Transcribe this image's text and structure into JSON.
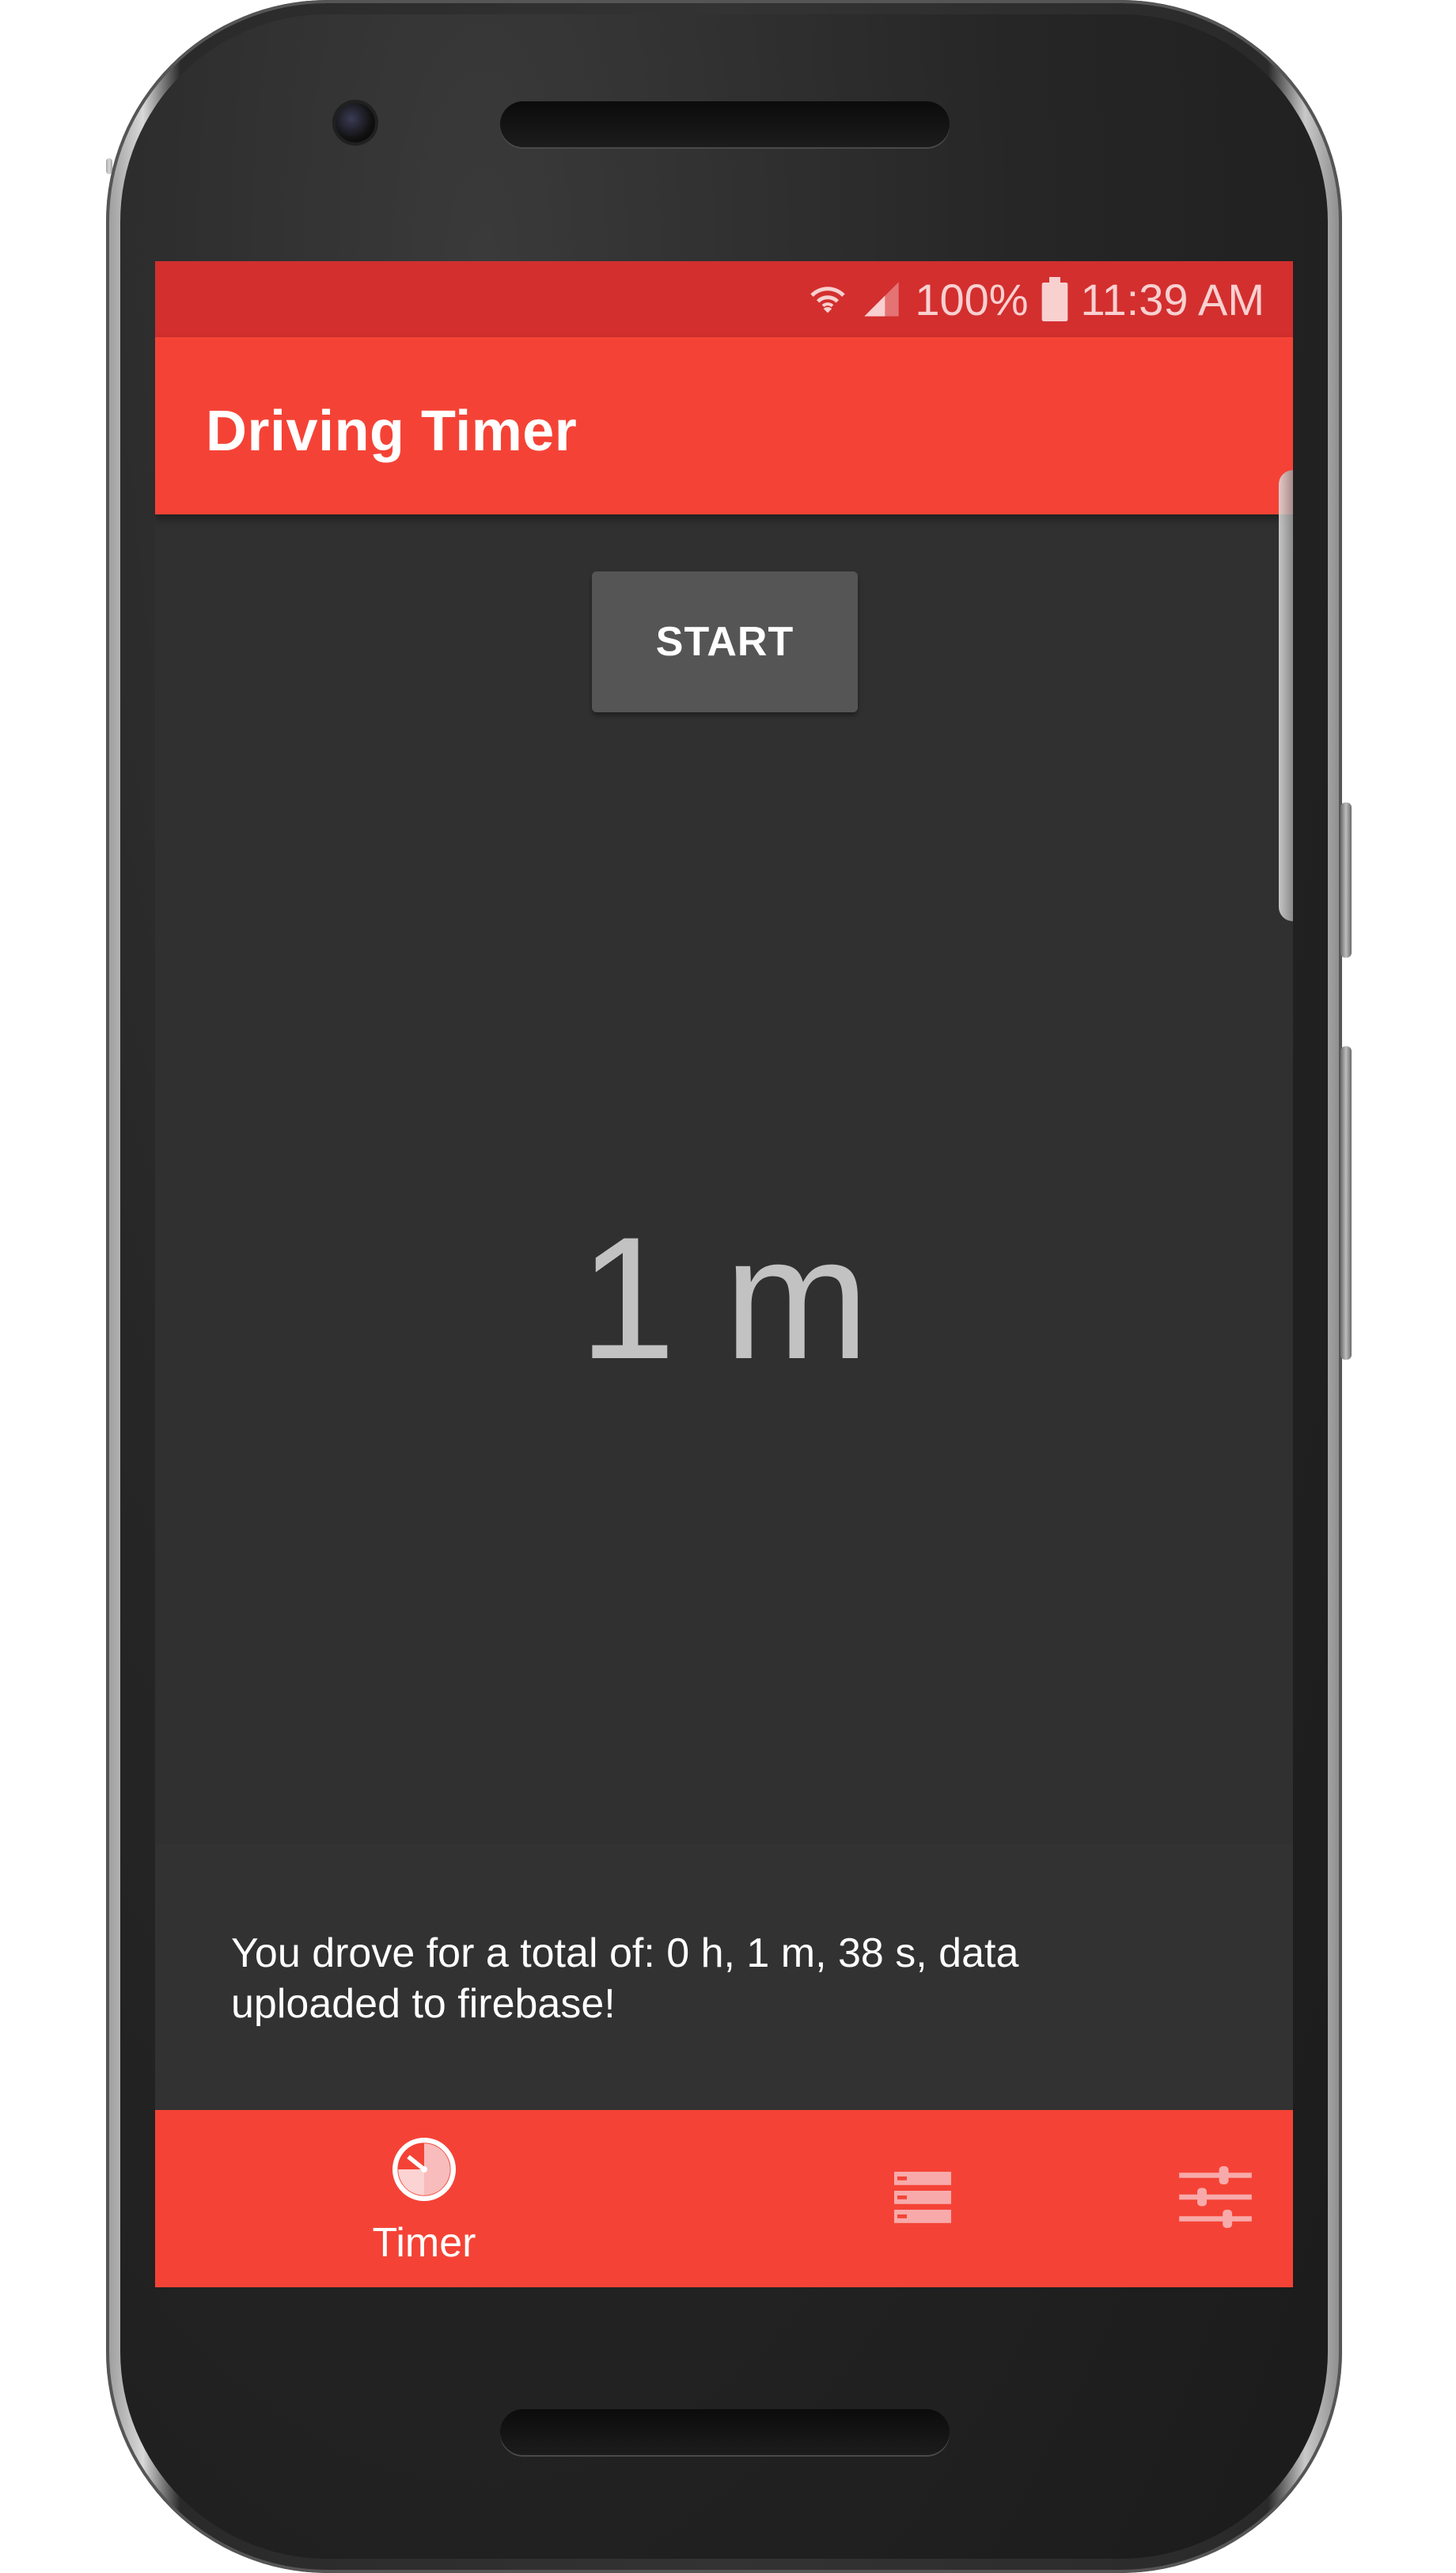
{
  "status_bar": {
    "battery": "100%",
    "time": "11:39 AM",
    "icons": [
      "wifi-icon",
      "cell-signal-icon",
      "battery-icon"
    ]
  },
  "app_bar": {
    "title": "Driving Timer"
  },
  "controls": {
    "start_label": "START"
  },
  "timer": {
    "display": "1 m"
  },
  "message": {
    "text": "You drove for a total of: 0 h, 1 m, 38 s, data uploaded to firebase!"
  },
  "bottom_nav": {
    "items": [
      {
        "label": "Timer",
        "icon": "timer-icon",
        "active": true
      },
      {
        "label": "",
        "icon": "list-icon",
        "active": false
      },
      {
        "label": "",
        "icon": "settings-sliders-icon",
        "active": false
      }
    ]
  },
  "colors": {
    "primary": "#f44336",
    "primary_dark": "#d32f2f",
    "background": "#303030",
    "button": "#555555"
  }
}
